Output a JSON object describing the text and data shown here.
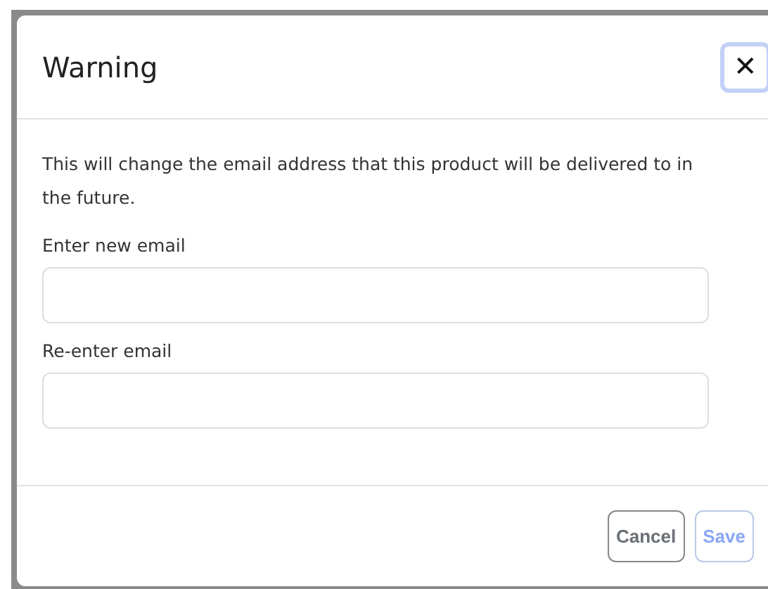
{
  "dialog": {
    "title": "Warning",
    "close": {
      "label": "✕",
      "focused": true
    },
    "message": "This will change the email address that this product will be delivered to in the future.",
    "fields": [
      {
        "label": "Enter new email"
      },
      {
        "label": "Re-enter email"
      }
    ],
    "buttons": [
      {
        "label": "Cancel",
        "kind": "secondary",
        "disabled": false
      },
      {
        "label": "Save",
        "kind": "primary",
        "disabled": true
      }
    ]
  }
}
